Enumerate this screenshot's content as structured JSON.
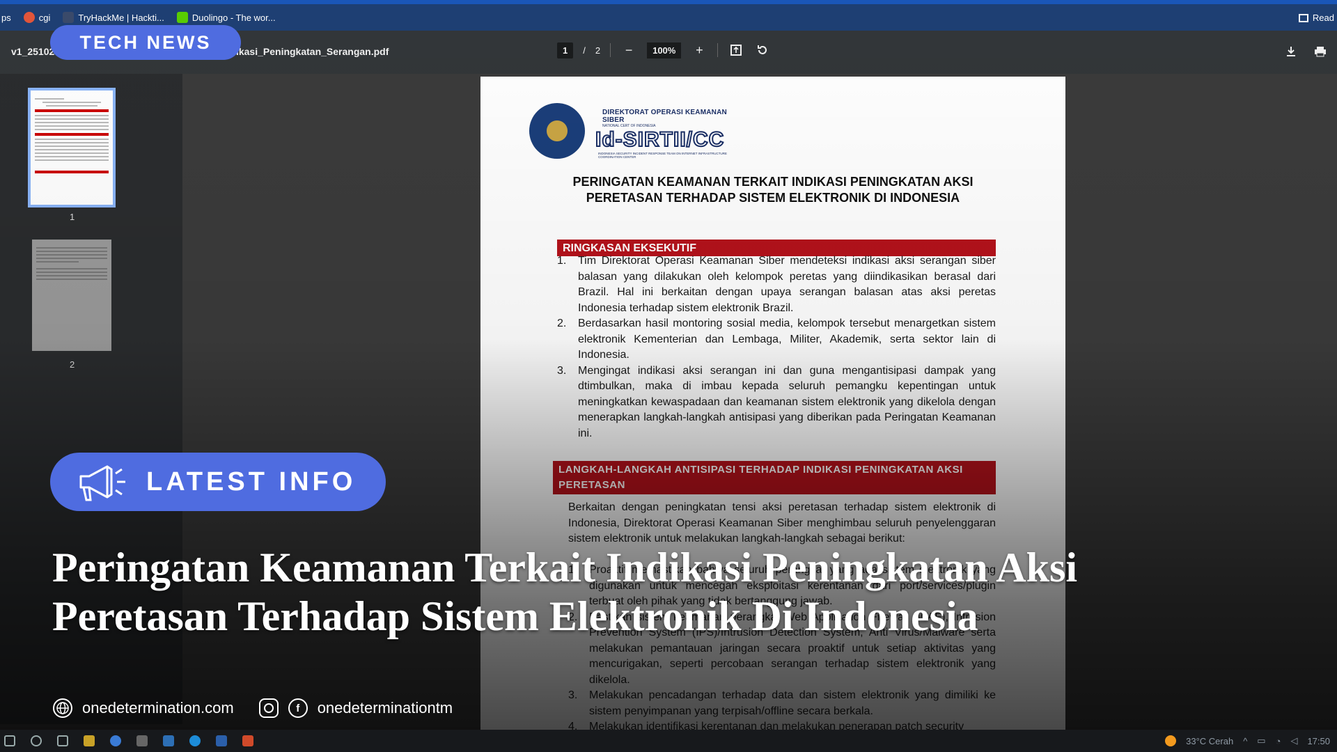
{
  "browser": {
    "bookmarks": [
      {
        "label": "ps",
        "icon": "bookmark-icon",
        "color": "#1e3f73"
      },
      {
        "label": "cgi",
        "icon": "link-icon",
        "color": "#e2553a"
      },
      {
        "label": "TryHackMe | Hackti...",
        "icon": "tryhackme-icon",
        "color": "#3a4a6a"
      },
      {
        "label": "Duolingo - The wor...",
        "icon": "duolingo-icon",
        "color": "#58cc02"
      }
    ],
    "reading_list_label": "Read"
  },
  "pdf_toolbar": {
    "filename": "v1_25102021_Peringatan_Keamanan_terkait_Indikasi_Peningkatan_Serangan.pdf",
    "current_page": "1",
    "page_separator": "/",
    "total_pages": "2",
    "zoom": "100%"
  },
  "sidebar": {
    "thumbnails": [
      {
        "label": "1"
      },
      {
        "label": "2"
      }
    ]
  },
  "document": {
    "org_small": "DIREKTORAT OPERASI KEAMANAN SIBER",
    "org_sub": "NATIONAL CERT OF INDONESIA",
    "org_big": "Id-SIRTII/CC",
    "org_tiny": "INDONESIA SECURITY INCIDENT RESPONSE TEAM ON INTERNET INFRASTRUCTURE COORDINATION CENTER",
    "title": "PERINGATAN KEAMANAN TERKAIT INDIKASI PENINGKATAN AKSI PERETASAN TERHADAP SISTEM ELEKTRONIK DI INDONESIA",
    "section1_heading": "RINGKASAN EKSEKUTIF",
    "section1_items": [
      {
        "n": "1.",
        "text": "Tim Direktorat Operasi Keamanan Siber mendeteksi indikasi aksi serangan siber balasan yang dilakukan oleh kelompok peretas yang diindikasikan berasal dari Brazil. Hal ini berkaitan dengan upaya serangan balasan atas aksi peretas Indonesia terhadap sistem elektronik Brazil."
      },
      {
        "n": "2.",
        "text": "Berdasarkan hasil montoring sosial media, kelompok tersebut menargetkan sistem elektronik Kementerian dan Lembaga, Militer, Akademik, serta sektor lain di Indonesia."
      },
      {
        "n": "3.",
        "text": "Mengingat indikasi aksi serangan ini dan guna mengantisipasi dampak yang dtimbulkan, maka di imbau kepada seluruh pemangku kepentingan untuk meningkatkan kewaspadaan dan keamanan sistem elektronik yang dikelola dengan menerapkan langkah-langkah antisipasi yang diberikan pada Peringatan Keamanan ini."
      }
    ],
    "section2_heading": "LANGKAH-LANGKAH ANTISIPASI TERHADAP INDIKASI PENINGKATAN AKSI PERETASAN",
    "section2_intro": "Berkaitan dengan peningkatan tensi aksi peretasan terhadap sistem elektronik di Indonesia, Direktorat Operasi Keamanan Siber menghimbau seluruh penyelenggaran sistem elektronik untuk melakukan langkah-langkah sebagai berikut:",
    "section2_items": [
      {
        "n": "1.",
        "text": "Proaktif memastikan bahwa seluruh perangkat yang ada sistem elektronik yang digunakan untuk mencegah eksploitasi kerentanan dari port/services/plugin terbuat oleh pihak yang tidak bertanggung jawab."
      },
      {
        "n": "2.",
        "text": "Pastikan sistem keamanan perangkat Web Application Firewall (WAF), Intrusion Prevention System (IPS)/Intrusion Detection System, Anti Virus/Malware serta melakukan pemantauan jaringan secara proaktif untuk setiap aktivitas yang mencurigakan, seperti percobaan serangan terhadap sistem elektronik yang dikelola."
      },
      {
        "n": "3.",
        "text": "Melakukan pencadangan terhadap data dan sistem elektronik yang dimiliki ke sistem penyimpanan yang terpisah/offline secara berkala."
      },
      {
        "n": "4.",
        "text": "Melakukan identifikasi kerentanan dan melakukan penerapan patch security"
      }
    ]
  },
  "overlay": {
    "tech_news": "TECH NEWS",
    "latest_info": "LATEST INFO",
    "headline": "Peringatan Keamanan Terkait Indikasi Peningkatan Aksi Peretasan Terhadap Sistem Elektronik Di Indonesia",
    "website": "onedetermination.com",
    "social_handle": "onedeterminationtm",
    "accent_color": "#4f6ce0"
  },
  "taskbar": {
    "weather": "33°C Cerah",
    "time": "17:50"
  }
}
